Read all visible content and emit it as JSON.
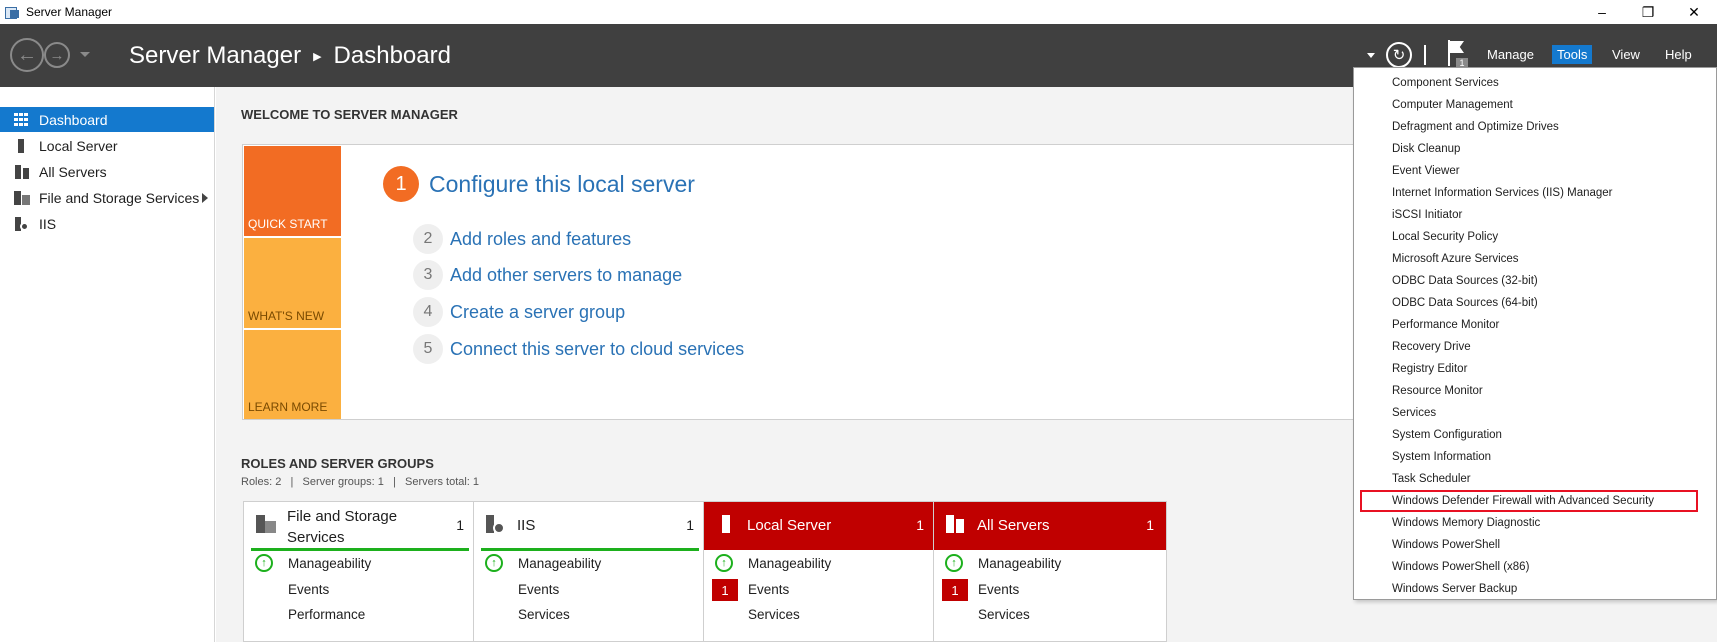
{
  "window": {
    "title": "Server Manager",
    "controls": [
      "–",
      "❐",
      "✕"
    ]
  },
  "header": {
    "breadcrumb_root": "Server Manager",
    "breadcrumb_page": "Dashboard",
    "notification_count": "1",
    "menus": [
      "Manage",
      "Tools",
      "View",
      "Help"
    ],
    "active_menu": "Tools"
  },
  "sidebar": {
    "items": [
      {
        "label": "Dashboard",
        "icon": "dashboard-icon",
        "active": true
      },
      {
        "label": "Local Server",
        "icon": "server-icon"
      },
      {
        "label": "All Servers",
        "icon": "servers-icon"
      },
      {
        "label": "File and Storage Services",
        "icon": "storage-icon",
        "has_submenu": true
      },
      {
        "label": "IIS",
        "icon": "iis-icon"
      }
    ]
  },
  "welcome": {
    "title": "WELCOME TO SERVER MANAGER",
    "tabs": [
      "QUICK START",
      "WHAT'S NEW",
      "LEARN MORE"
    ],
    "steps": [
      {
        "num": "1",
        "label": "Configure this local server"
      },
      {
        "num": "2",
        "label": "Add roles and features"
      },
      {
        "num": "3",
        "label": "Add other servers to manage"
      },
      {
        "num": "4",
        "label": "Create a server group"
      },
      {
        "num": "5",
        "label": "Connect this server to cloud services"
      }
    ]
  },
  "roles": {
    "title": "ROLES AND SERVER GROUPS",
    "summary": "Roles: 2   |   Server groups: 1   |   Servers total: 1",
    "tiles": [
      {
        "name_line1": "File and Storage",
        "name_line2": "Services",
        "count": "1",
        "status": "ok",
        "rows": [
          "Manageability",
          "Events",
          "Performance"
        ]
      },
      {
        "name_line1": "IIS",
        "count": "1",
        "status": "ok",
        "rows": [
          "Manageability",
          "Events",
          "Services"
        ]
      },
      {
        "name_line1": "Local Server",
        "count": "1",
        "status": "alert",
        "rows": [
          "Manageability",
          "Events",
          "Services"
        ],
        "events_badge": "1"
      },
      {
        "name_line1": "All Servers",
        "count": "1",
        "status": "alert",
        "rows": [
          "Manageability",
          "Events",
          "Services"
        ],
        "events_badge": "1"
      }
    ]
  },
  "tools_menu": {
    "items": [
      "Component Services",
      "Computer Management",
      "Defragment and Optimize Drives",
      "Disk Cleanup",
      "Event Viewer",
      "Internet Information Services (IIS) Manager",
      "iSCSI Initiator",
      "Local Security Policy",
      "Microsoft Azure Services",
      "ODBC Data Sources (32-bit)",
      "ODBC Data Sources (64-bit)",
      "Performance Monitor",
      "Recovery Drive",
      "Registry Editor",
      "Resource Monitor",
      "Services",
      "System Configuration",
      "System Information",
      "Task Scheduler",
      "Windows Defender Firewall with Advanced Security",
      "Windows Memory Diagnostic",
      "Windows PowerShell",
      "Windows PowerShell (x86)",
      "Windows Server Backup"
    ],
    "highlighted_index": 19
  },
  "colors": {
    "header_bg": "#404040",
    "accent_blue": "#1479ce",
    "quick_start_orange": "#f26c23",
    "tab_yellow": "#fbb040",
    "alert_red": "#c00000",
    "ok_green": "#1db01d",
    "highlight_red": "#e81123"
  }
}
